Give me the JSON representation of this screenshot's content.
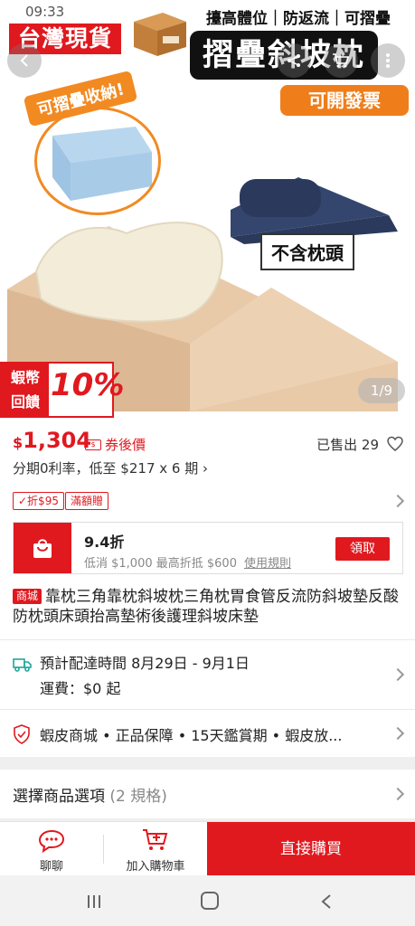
{
  "status_bar": {
    "time": "09:33"
  },
  "hero": {
    "badge": "台灣現貨",
    "top_features": "擡高體位｜防返流｜可摺疊",
    "main_title": "摺疊斜坡枕",
    "invoice": "可開發票",
    "foldable_label": "可摺疊收納!",
    "no_pillow": "不含枕頭",
    "coins_line1": "蝦幣",
    "coins_line2": "回饋",
    "coins_percent": "10%",
    "pager": "1/9"
  },
  "price": {
    "currency": "$",
    "amount": "1,304",
    "coupon_label": "券後價",
    "sold": "已售出 29",
    "installment": "分期0利率，低至 $217 x 6 期 ›"
  },
  "vouchers": {
    "tag1": "✓折$95",
    "tag2": "滿額贈"
  },
  "coupon": {
    "title": "9.4折",
    "desc": "低消 $1,000 最高折抵 $600",
    "rules": "使用規則",
    "claim": "領取"
  },
  "product": {
    "mall_badge": "商城",
    "title": "靠枕三角靠枕斜坡枕三角枕胃食管反流防斜坡墊反酸防枕頭床頭抬高墊術後護理斜坡床墊"
  },
  "shipping": {
    "eta": "預計配達時間 8月29日 - 9月1日",
    "fee": "運費：$0 起"
  },
  "guarantee": {
    "text": "蝦皮商城 • 正品保障 • 15天鑑賞期 • 蝦皮放..."
  },
  "options": {
    "label": "選擇商品選項",
    "count": "(2 規格)"
  },
  "bottom_bar": {
    "chat": "聊聊",
    "add_to_cart": "加入購物車",
    "buy_now": "直接購買"
  },
  "colors": {
    "brand_red": "#e0191f",
    "orange": "#ef7e1a",
    "wedge_beige": "#e8c9a8",
    "pillow_cream": "#f3ecd9",
    "navy": "#2b3a5c"
  }
}
